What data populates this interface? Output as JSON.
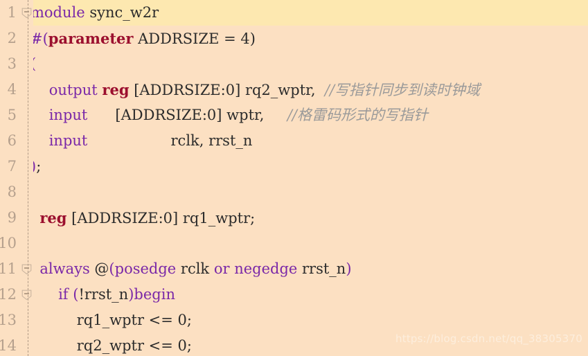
{
  "editor": {
    "background_color": "#fce0c2",
    "highlight_color": "#fde8b0",
    "gutter_number_color": "#b5a08d",
    "keyword_color": "#7a28a8",
    "type_color": "#9b0f2e",
    "comment_color": "#9a9a9a",
    "text_color": "#2b2b2b",
    "language": "Verilog"
  },
  "watermark": {
    "text": "https://blog.csdn.net/qq_38305370"
  },
  "gutter": [
    {
      "number": "1",
      "fold": "collapse"
    },
    {
      "number": "2",
      "fold": "none"
    },
    {
      "number": "3",
      "fold": "none"
    },
    {
      "number": "4",
      "fold": "none"
    },
    {
      "number": "5",
      "fold": "none"
    },
    {
      "number": "6",
      "fold": "none"
    },
    {
      "number": "7",
      "fold": "none"
    },
    {
      "number": "8",
      "fold": "none"
    },
    {
      "number": "9",
      "fold": "none"
    },
    {
      "number": "10",
      "fold": "none"
    },
    {
      "number": "11",
      "fold": "collapse"
    },
    {
      "number": "12",
      "fold": "collapse"
    },
    {
      "number": "13",
      "fold": "none"
    },
    {
      "number": "14",
      "fold": "none"
    }
  ],
  "lines": [
    {
      "n": 1,
      "highlighted": true,
      "plain": "module sync_w2r",
      "tokens": [
        {
          "t": "module",
          "c": "kw"
        },
        {
          "t": " sync_w2r",
          "c": "txt"
        }
      ]
    },
    {
      "n": 2,
      "highlighted": false,
      "plain": "#(parameter ADDRSIZE = 4)",
      "tokens": [
        {
          "t": "#(",
          "c": "kw"
        },
        {
          "t": "parameter",
          "c": "type"
        },
        {
          "t": " ADDRSIZE = 4)",
          "c": "txt"
        }
      ]
    },
    {
      "n": 3,
      "highlighted": false,
      "plain": "(",
      "tokens": [
        {
          "t": "(",
          "c": "kw"
        }
      ]
    },
    {
      "n": 4,
      "highlighted": false,
      "plain": "    output reg [ADDRSIZE:0] rq2_wptr,  //写指针同步到读时钟域",
      "tokens": [
        {
          "t": "    ",
          "c": "txt"
        },
        {
          "t": "output",
          "c": "kw"
        },
        {
          "t": " ",
          "c": "txt"
        },
        {
          "t": "reg",
          "c": "type"
        },
        {
          "t": " [ADDRSIZE:0] rq2_wptr,  ",
          "c": "txt"
        },
        {
          "t": "//写指针同步到读时钟域",
          "c": "cmt"
        }
      ]
    },
    {
      "n": 5,
      "highlighted": false,
      "plain": "    input      [ADDRSIZE:0] wptr,       //格雷码形式的写指针",
      "tokens": [
        {
          "t": "    ",
          "c": "txt"
        },
        {
          "t": "input",
          "c": "kw"
        },
        {
          "t": "      [ADDRSIZE:0] wptr,     ",
          "c": "txt"
        },
        {
          "t": "//格雷码形式的写指针",
          "c": "cmt"
        }
      ]
    },
    {
      "n": 6,
      "highlighted": false,
      "plain": "    input                rclk, rrst_n",
      "tokens": [
        {
          "t": "    ",
          "c": "txt"
        },
        {
          "t": "input",
          "c": "kw"
        },
        {
          "t": "                  rclk, rrst_n",
          "c": "txt"
        }
      ]
    },
    {
      "n": 7,
      "highlighted": false,
      "plain": ");",
      "tokens": [
        {
          "t": ")",
          "c": "kw"
        },
        {
          "t": ";",
          "c": "txt"
        }
      ]
    },
    {
      "n": 8,
      "highlighted": false,
      "plain": "",
      "tokens": []
    },
    {
      "n": 9,
      "highlighted": false,
      "plain": "  reg [ADDRSIZE:0] rq1_wptr;",
      "tokens": [
        {
          "t": "  ",
          "c": "txt"
        },
        {
          "t": "reg",
          "c": "type"
        },
        {
          "t": " [ADDRSIZE:0] rq1_wptr;",
          "c": "txt"
        }
      ]
    },
    {
      "n": 10,
      "highlighted": false,
      "plain": "",
      "tokens": []
    },
    {
      "n": 11,
      "highlighted": false,
      "plain": "  always @(posedge rclk or negedge rrst_n)",
      "tokens": [
        {
          "t": "  ",
          "c": "txt"
        },
        {
          "t": "always",
          "c": "kw"
        },
        {
          "t": " @",
          "c": "txt"
        },
        {
          "t": "(",
          "c": "kw"
        },
        {
          "t": "posedge",
          "c": "kw"
        },
        {
          "t": " rclk ",
          "c": "txt"
        },
        {
          "t": "or",
          "c": "kw"
        },
        {
          "t": " ",
          "c": "txt"
        },
        {
          "t": "negedge",
          "c": "kw"
        },
        {
          "t": " rrst_n",
          "c": "txt"
        },
        {
          "t": ")",
          "c": "kw"
        }
      ]
    },
    {
      "n": 12,
      "highlighted": false,
      "plain": "      if (!rrst_n)begin",
      "tokens": [
        {
          "t": "      ",
          "c": "txt"
        },
        {
          "t": "if",
          "c": "kw"
        },
        {
          "t": " ",
          "c": "txt"
        },
        {
          "t": "(",
          "c": "kw"
        },
        {
          "t": "!rrst_n",
          "c": "txt"
        },
        {
          "t": ")",
          "c": "kw"
        },
        {
          "t": "begin",
          "c": "kw"
        }
      ]
    },
    {
      "n": 13,
      "highlighted": false,
      "plain": "          rq1_wptr <= 0;",
      "tokens": [
        {
          "t": "          rq1_wptr <= 0;",
          "c": "txt"
        }
      ]
    },
    {
      "n": 14,
      "highlighted": false,
      "plain": "          rq2_wptr <= 0;",
      "tokens": [
        {
          "t": "          rq2_wptr <= 0;",
          "c": "txt"
        }
      ]
    }
  ]
}
